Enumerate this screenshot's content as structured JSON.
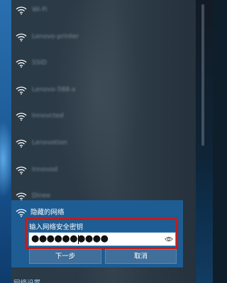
{
  "networks": [
    {
      "name": "Wi-Fi"
    },
    {
      "name": "Lenovo-printer"
    },
    {
      "name": "SSID"
    },
    {
      "name": "Lenovo-588-x"
    },
    {
      "name": "Innovcted"
    },
    {
      "name": "Lenovotion"
    },
    {
      "name": "Innovod"
    },
    {
      "name": "Dinee"
    }
  ],
  "hidden_network": {
    "title": "隐藏的网络",
    "key_label": "输入网络安全密钥",
    "password_value": "●●●●●●●●●●",
    "next_label": "下一步",
    "cancel_label": "取消"
  },
  "footer": {
    "settings_link": "网络设置"
  },
  "colors": {
    "panel_highlight": "#1e5d93",
    "annotation_frame": "#c8191b",
    "button": "#3f6f9a",
    "link": "#9ccbef"
  },
  "icons": {
    "network": "wifi-icon",
    "reveal": "eye-icon"
  }
}
